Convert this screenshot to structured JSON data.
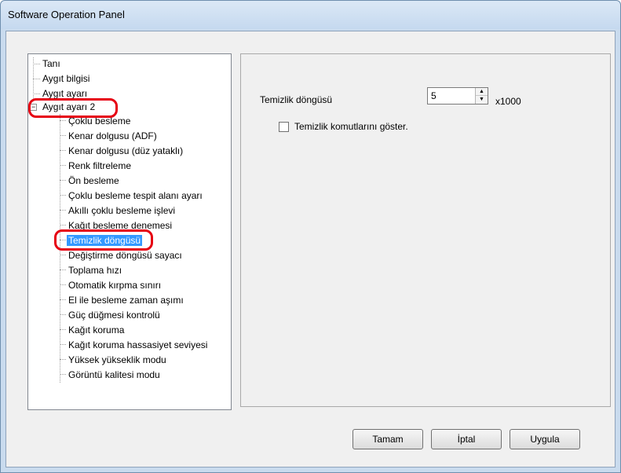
{
  "window": {
    "title": "Software Operation Panel"
  },
  "tree": {
    "items": [
      {
        "label": "Tanı"
      },
      {
        "label": "Aygıt bilgisi"
      },
      {
        "label": "Aygıt ayarı"
      },
      {
        "label": "Aygıt ayarı 2",
        "expander": "−"
      },
      {
        "label": "Çoklu besleme"
      },
      {
        "label": "Kenar dolgusu (ADF)"
      },
      {
        "label": "Kenar dolgusu (düz yataklı)"
      },
      {
        "label": "Renk filtreleme"
      },
      {
        "label": "Ön besleme"
      },
      {
        "label": "Çoklu besleme tespit alanı ayarı"
      },
      {
        "label": "Akıllı çoklu besleme işlevi"
      },
      {
        "label": "Kağıt besleme denemesi"
      },
      {
        "label": "Temizlik döngüsü",
        "selected": true
      },
      {
        "label": "Değiştirme döngüsü sayacı"
      },
      {
        "label": "Toplama hızı"
      },
      {
        "label": "Otomatik kırpma sınırı"
      },
      {
        "label": "El ile besleme zaman aşımı"
      },
      {
        "label": "Güç düğmesi kontrolü"
      },
      {
        "label": "Kağıt koruma"
      },
      {
        "label": "Kağıt koruma hassasiyet seviyesi"
      },
      {
        "label": "Yüksek yükseklik modu"
      },
      {
        "label": "Görüntü kalitesi modu"
      }
    ]
  },
  "settings": {
    "cycle_label": "Temizlik döngüsü",
    "cycle_value": "5",
    "cycle_unit": "x1000",
    "show_command_label": "Temizlik komutlarını göster.",
    "show_command_checked": false
  },
  "buttons": {
    "ok": "Tamam",
    "cancel": "İptal",
    "apply": "Uygula"
  },
  "annotation_color": "#e60012",
  "selection_color": "#3399ff"
}
